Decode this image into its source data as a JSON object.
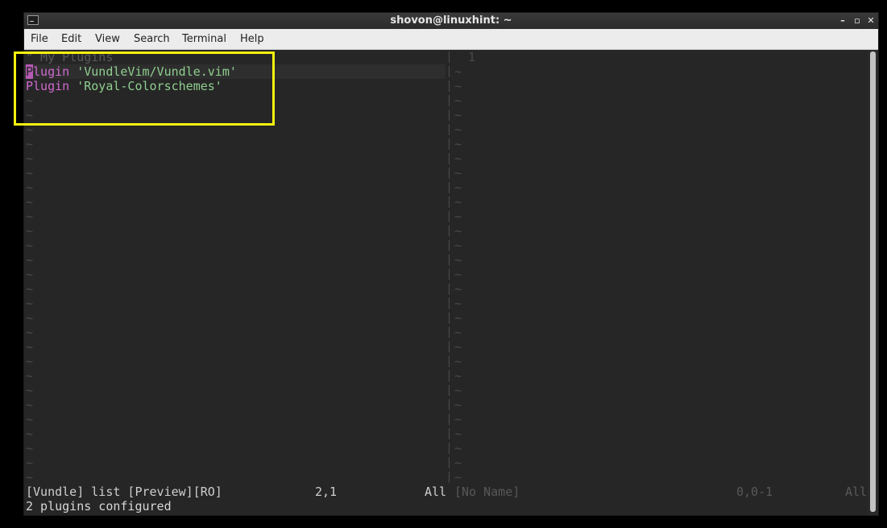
{
  "window": {
    "title": "shovon@linuxhint: ~",
    "icon": "terminal-icon",
    "controls": {
      "minimize": "–",
      "maximize": "▫",
      "close": "✕"
    }
  },
  "menu": [
    "File",
    "Edit",
    "View",
    "Search",
    "Terminal",
    "Help"
  ],
  "editor": {
    "left_pane": {
      "comment": "\" My Plugins",
      "lines": [
        {
          "keyword": "Plugin",
          "value": " 'VundleVim/Vundle.vim'"
        },
        {
          "keyword": "Plugin",
          "value": " 'Royal-Colorschemes'"
        }
      ],
      "cursor_char": "P",
      "filler": "~"
    },
    "right_pane": {
      "line_number": "1",
      "filler": "~"
    },
    "status_left": {
      "name": "[Vundle] list [Preview][RO]",
      "position": "2,1",
      "scroll": "All"
    },
    "status_right": {
      "name": "[No Name]",
      "position": "0,0-1",
      "scroll": "All"
    },
    "message": "2 plugins configured"
  },
  "annotation_color": "#f7f00f",
  "colors": {
    "keyword": "#d06ad0",
    "string": "#8fce8f",
    "background": "#262626"
  }
}
